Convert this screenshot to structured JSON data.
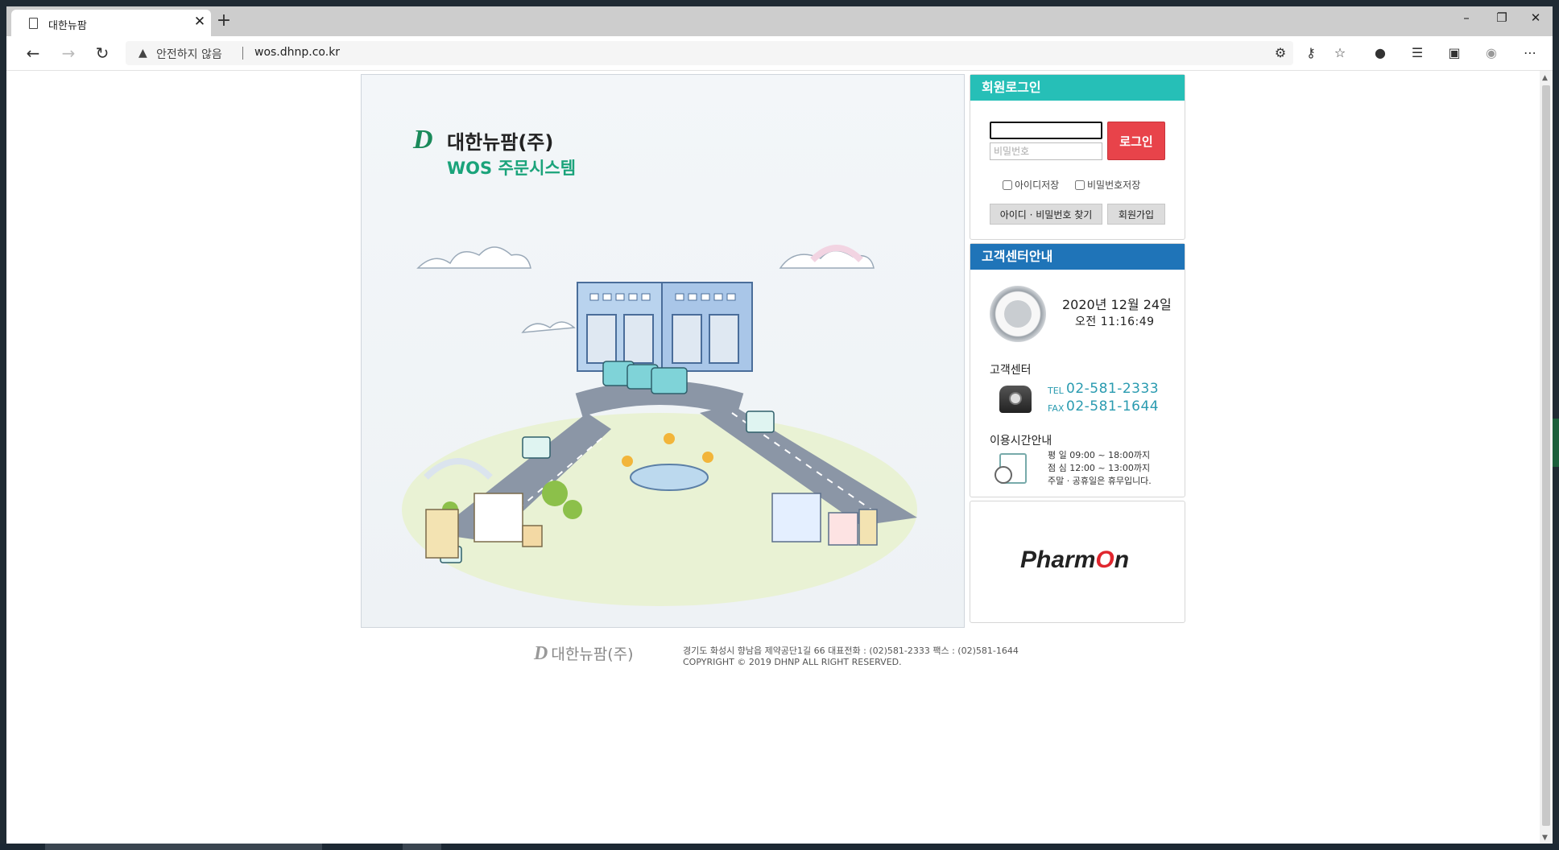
{
  "browser": {
    "tab_title": "대한뉴팜",
    "tab_close": "✕",
    "new_tab": "+",
    "security_warning": "안전하지 않음",
    "url": "wos.dhnp.co.kr",
    "window_controls": {
      "minimize": "–",
      "restore": "❐",
      "close": "✕"
    }
  },
  "hero": {
    "brand_mark": "D",
    "brand_name": "대한뉴팜(주)",
    "brand_subtitle": "WOS 주문시스템"
  },
  "login": {
    "title": "회원로그인",
    "id_value": "",
    "password_placeholder": "비밀번호",
    "login_button": "로그인",
    "save_id": "아이디저장",
    "save_password": "비밀번호저장",
    "find_button": "아이디 · 비밀번호 찾기",
    "signup_button": "회원가입"
  },
  "service": {
    "title": "고객센터안내",
    "date": "2020년 12월 24일",
    "time": "오전 11:16:49",
    "center_title": "고객센터",
    "tel_label": "TEL",
    "tel": "02-581-2333",
    "fax_label": "FAX",
    "fax": "02-581-1644",
    "hours_title": "이용시간안내",
    "hours": [
      "평 일  09:00 ~ 18:00까지",
      "점 심  12:00 ~ 13:00까지",
      "주말 · 공휴일은 휴무입니다."
    ]
  },
  "banner": {
    "text_left": "Pharm",
    "text_o": "O",
    "text_right": "n"
  },
  "footer": {
    "logo_mark": "D",
    "logo_name": "대한뉴팜(주)",
    "address": "경기도 화성시 향남읍 제약공단1길 66  대표전화 : (02)581-2333  팩스 : (02)581-1644",
    "copyright": "COPYRIGHT © 2019 DHNP ALL RIGHT RESERVED."
  },
  "colors": {
    "login_header": "#26bfb7",
    "service_header": "#1f74b8",
    "login_button": "#e8434a",
    "tel_text": "#2a9bb0"
  }
}
